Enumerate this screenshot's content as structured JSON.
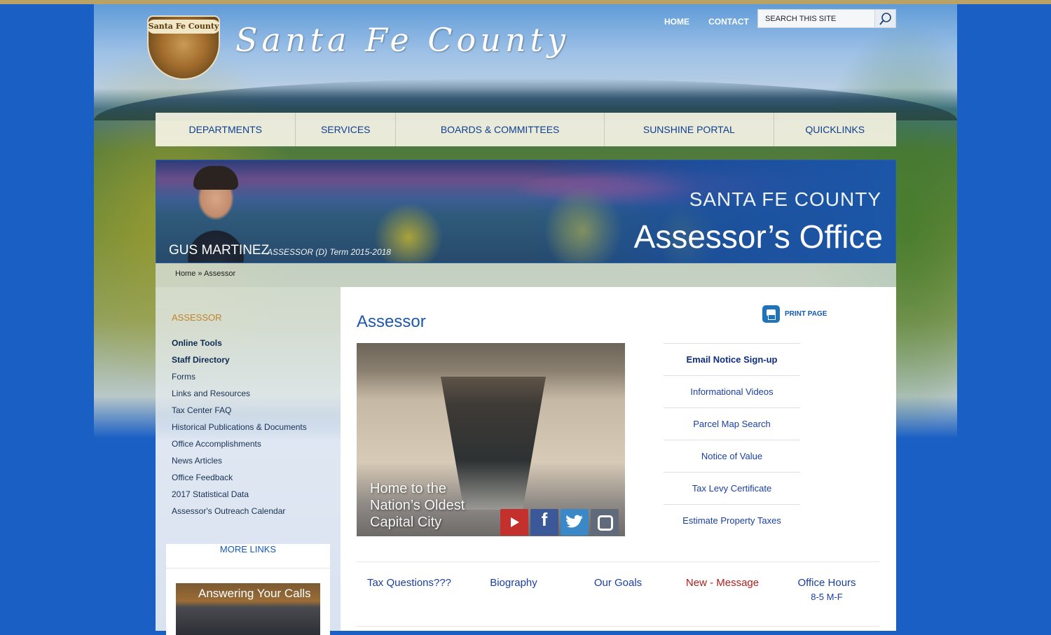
{
  "site": {
    "title": "Santa Fe County",
    "logo_text": "Santa Fe County"
  },
  "topnav": {
    "home": "HOME",
    "contact": "CONTACT",
    "search_placeholder": "SEARCH THIS SITE"
  },
  "mainnav": [
    "DEPARTMENTS",
    "SERVICES",
    "BOARDS & COMMITTEES",
    "SUNSHINE PORTAL",
    "QUICKLINKS"
  ],
  "banner": {
    "county": "SANTA FE COUNTY",
    "office": "Assessor’s Office",
    "official_name": "GUS MARTINEZ",
    "official_title": "ASSESSOR (D) Term 2015-2018"
  },
  "breadcrumb": "Home » Assessor",
  "sidebar": {
    "heading": "ASSESSOR",
    "items": [
      {
        "label": "Online Tools",
        "bold": true
      },
      {
        "label": "Staff Directory",
        "bold": true
      },
      {
        "label": "Forms"
      },
      {
        "label": "Links and Resources"
      },
      {
        "label": "Tax Center FAQ"
      },
      {
        "label": "Historical Publications & Documents"
      },
      {
        "label": "Office Accomplishments"
      },
      {
        "label": "News Articles"
      },
      {
        "label": "Office Feedback"
      },
      {
        "label": "2017 Statistical Data"
      },
      {
        "label": "Assessor's Outreach Calendar"
      }
    ],
    "more_links": "MORE LINKS",
    "promo_text": "Answering Your Calls"
  },
  "content": {
    "title": "Assessor",
    "print_label": "PRINT PAGE",
    "photo_caption": [
      "Home to the",
      "Nation’s Oldest",
      "Capital City"
    ],
    "quicklinks": [
      {
        "label": "Email Notice Sign-up",
        "bold": true
      },
      {
        "label": "Informational Videos"
      },
      {
        "label": "Parcel Map Search"
      },
      {
        "label": "Notice of Value"
      },
      {
        "label": "Tax Levy Certificate"
      },
      {
        "label": "Estimate Property Taxes"
      }
    ],
    "bottom_links": [
      {
        "label": "Tax Questions???"
      },
      {
        "label": "Biography"
      },
      {
        "label": "Our Goals"
      },
      {
        "label": "New - Message",
        "color": "#b01e1e"
      },
      {
        "label": "Office Hours",
        "sub": "8-5 M-F"
      }
    ]
  },
  "colors": {
    "page_bg": "#1a5fc4",
    "link_blue": "#1a3fa0",
    "heading_blue": "#1e58a8",
    "sidebar_heading": "#c1832e",
    "alert_red": "#b01e1e"
  },
  "social_icons": [
    "youtube-icon",
    "facebook-icon",
    "twitter-icon",
    "instagram-icon"
  ]
}
